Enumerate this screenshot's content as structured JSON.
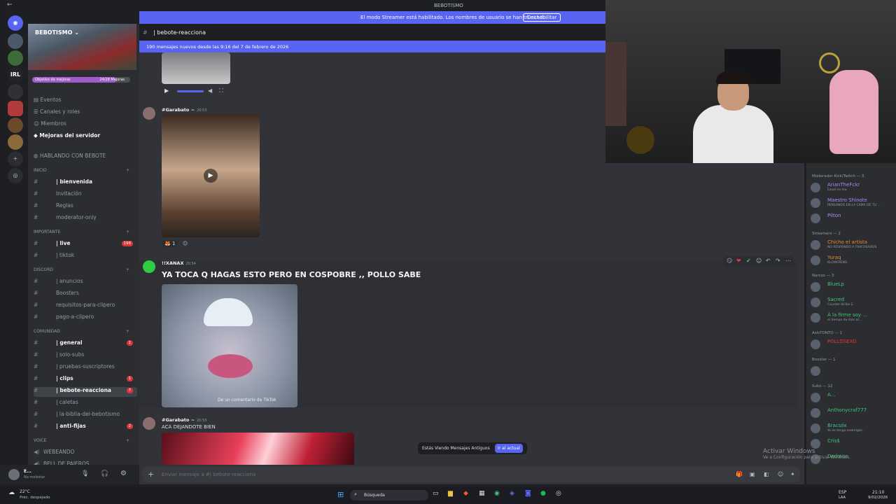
{
  "window": {
    "title": "BEBOTISMO"
  },
  "streamer_bar": {
    "message": "El modo Streamer está habilitado. Los nombres de usuario se han truncado.",
    "button": "Deshabilitar"
  },
  "server": {
    "name": "BEBOTISMO",
    "boost_goal_label": "Objetivo de mejoras",
    "boost_count": "24/28 Mejoras",
    "boost_progress": 0.857,
    "menu": [
      "Eventos",
      "Canales y roles",
      "Miembros",
      "Mejoras del servidor"
    ],
    "header_item": "HABLANDO CON BEBOTE",
    "sections": [
      {
        "category": "INICIO",
        "channels": [
          {
            "name": "| bienvenida",
            "unread": true
          },
          {
            "name": "Invitación",
            "unread": false
          },
          {
            "name": "Reglas",
            "unread": false
          },
          {
            "name": "moderator-only",
            "unread": false
          }
        ]
      },
      {
        "category": "IMPORTANTE",
        "channels": [
          {
            "name": "| live",
            "unread": true,
            "badge": "198"
          },
          {
            "name": "| tiktok",
            "unread": false
          }
        ]
      },
      {
        "category": "DISCORD",
        "channels": [
          {
            "name": "| anuncios",
            "unread": false
          },
          {
            "name": "Boosters",
            "unread": false
          },
          {
            "name": "requisitos-para-clipero",
            "unread": false
          },
          {
            "name": "pago-a-clipero",
            "unread": false
          }
        ]
      },
      {
        "category": "COMUNIDAD",
        "channels": [
          {
            "name": "| general",
            "unread": true,
            "badge": "1"
          },
          {
            "name": "| solo-subs",
            "unread": false
          },
          {
            "name": "| pruebas-suscriptores",
            "unread": false
          },
          {
            "name": "| clips",
            "unread": true,
            "badge": "1"
          },
          {
            "name": "| bebote-reacciona",
            "unread": true,
            "badge": "7",
            "selected": true
          },
          {
            "name": "| caletas",
            "unread": false
          },
          {
            "name": "| la-biblia-del-bebotismo",
            "unread": false
          },
          {
            "name": "| anti-fijas",
            "unread": true,
            "badge": "2"
          }
        ]
      },
      {
        "category": "VOICE",
        "channels": [
          {
            "name": "WEBEANDO",
            "unread": false
          },
          {
            "name": "BELL DE PAJEROS",
            "unread": false
          }
        ]
      }
    ],
    "user": {
      "name": "E...",
      "status": "No molestar"
    }
  },
  "channel": {
    "name": "| bebote-reacciona",
    "new_messages_banner": "190 mensajes nuevos desde las 9:16 del 7 de febrero de 2026"
  },
  "messages": [
    {
      "author": "#Garabato ~",
      "time": "20:53",
      "reaction_count": "1"
    },
    {
      "author": "!!XANAX",
      "time": "20:54",
      "text": "YA TOCA Q HAGAS ESTO PERO EN COSPOBRE ,, POLLO SABE",
      "media_caption": "De un comentario de TikTok"
    },
    {
      "author": "#Garabato ~",
      "time": "20:55",
      "text": "ACA DEJANDOTE BIEN"
    }
  ],
  "jump_bar": {
    "label": "Estás Viendo Mensajes Antiguos",
    "button": "Ir al actual"
  },
  "composer": {
    "placeholder": "Enviar mensaje a #| bebote-reacciona"
  },
  "members": [
    {
      "category": "Moderador Kick/Twitch — 3",
      "items": [
        {
          "name": "ArianTheFckr",
          "status": "Ezual no ma",
          "color": "#a58bff"
        },
        {
          "name": "Maestro Shinote",
          "status": "PENSANDO EN LA CAMA DE TU ...",
          "color": "#a58bff"
        },
        {
          "name": "Pilton",
          "status": "",
          "color": "#a58bff"
        }
      ]
    },
    {
      "category": "Streamers — 2",
      "items": [
        {
          "name": "Chicho el artista",
          "status": "NO RESPONDO A FRACASADOS",
          "color": "#e58b2f"
        },
        {
          "name": "Yuraq",
          "status": "KLOWFRENS",
          "color": "#e58b2f"
        }
      ]
    },
    {
      "category": "Narcos — 3",
      "items": [
        {
          "name": "BlueLp",
          "status": "",
          "color": "#3ec57a"
        },
        {
          "name": "Sacred",
          "status": "Counter-Strike 2",
          "color": "#3ec57a"
        },
        {
          "name": "À la firme soy ...",
          "status": "el tiempo de dios es...",
          "color": "#3ec57a"
        }
      ]
    },
    {
      "category": "AsIsTONTO — 1",
      "items": [
        {
          "name": "POLLOSEXO",
          "status": "",
          "color": "#e8343a"
        }
      ]
    },
    {
      "category": "Booster — 1",
      "items": [
        {
          "name": "",
          "status": "",
          "color": "#f47fff"
        }
      ]
    },
    {
      "category": "Subs — 12",
      "items": [
        {
          "name": "A...",
          "status": "",
          "color": "#3ec57a"
        },
        {
          "name": "Anthonycraf777",
          "status": "",
          "color": "#3ec57a"
        },
        {
          "name": "Bracsöx",
          "status": "Yo no tengo enemigos.",
          "color": "#3ec57a"
        },
        {
          "name": "Cris$",
          "status": "",
          "color": "#3ec57a"
        },
        {
          "name": "Dedmon",
          "status": "",
          "color": "#3ec57a"
        }
      ]
    }
  ],
  "watermark": {
    "title": "Activar Windows",
    "subtitle": "Ve a Configuración para activar Windows."
  },
  "taskbar": {
    "weather_temp": "22°C",
    "weather_desc": "Prec. despejado",
    "search": "Búsqueda",
    "lang": "ESP",
    "lang2": "LAA",
    "time": "21:10",
    "date": "9/02/2026"
  },
  "colors": {
    "accent": "#5865f2",
    "badge": "#da373c"
  }
}
